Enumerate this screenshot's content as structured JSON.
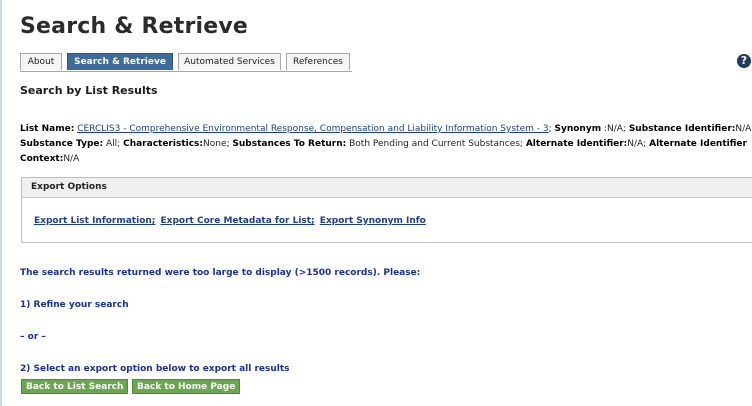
{
  "page": {
    "title": "Search & Retrieve",
    "subtitle": "Search by List Results"
  },
  "tabs": [
    {
      "label": "About",
      "active": false
    },
    {
      "label": "Search & Retrieve",
      "active": true
    },
    {
      "label": "Automated Services",
      "active": false
    },
    {
      "label": "References",
      "active": false
    }
  ],
  "help_icon": {
    "glyph": "?",
    "icon": "help-icon"
  },
  "params": {
    "list_name_label": "List Name:",
    "list_name_value": "CERCLIS3 - Comprehensive Environmental Response, Compensation and Liability Information System - 3",
    "synonym_label": "Synonym",
    "synonym_value": ":N/A;",
    "substance_identifier_label": "Substance Identifier:",
    "substance_identifier_value": "N/A;",
    "substance_type_label": "Substance Type:",
    "substance_type_value": "All;",
    "characteristics_label": "Characteristics:",
    "characteristics_value": "None;",
    "substances_to_return_label": "Substances To Return:",
    "substances_to_return_value": "Both Pending and Current Substances;",
    "alternate_identifier_label": "Alternate Identifier:",
    "alternate_identifier_value": "N/A;",
    "alternate_identifier_context_label": "Alternate Identifier Context:",
    "alternate_identifier_context_value": "N/A"
  },
  "export": {
    "heading": "Export Options",
    "links": [
      "Export List Information;",
      "Export Core Metadata for List;",
      "Export Synonym Info"
    ]
  },
  "messages": {
    "too_large": "The search results returned were too large to display (>1500 records). Please:",
    "refine": "1) Refine your search",
    "or": "– or –",
    "select_export": "2) Select an export option below to export all results"
  },
  "buttons": {
    "back_list": "Back to List Search",
    "back_home": "Back to Home Page"
  },
  "colors": {
    "active_tab": "#3e6b9b",
    "link": "#1c3f94",
    "message": "#1a2fa4",
    "button": "#6aa84f"
  }
}
